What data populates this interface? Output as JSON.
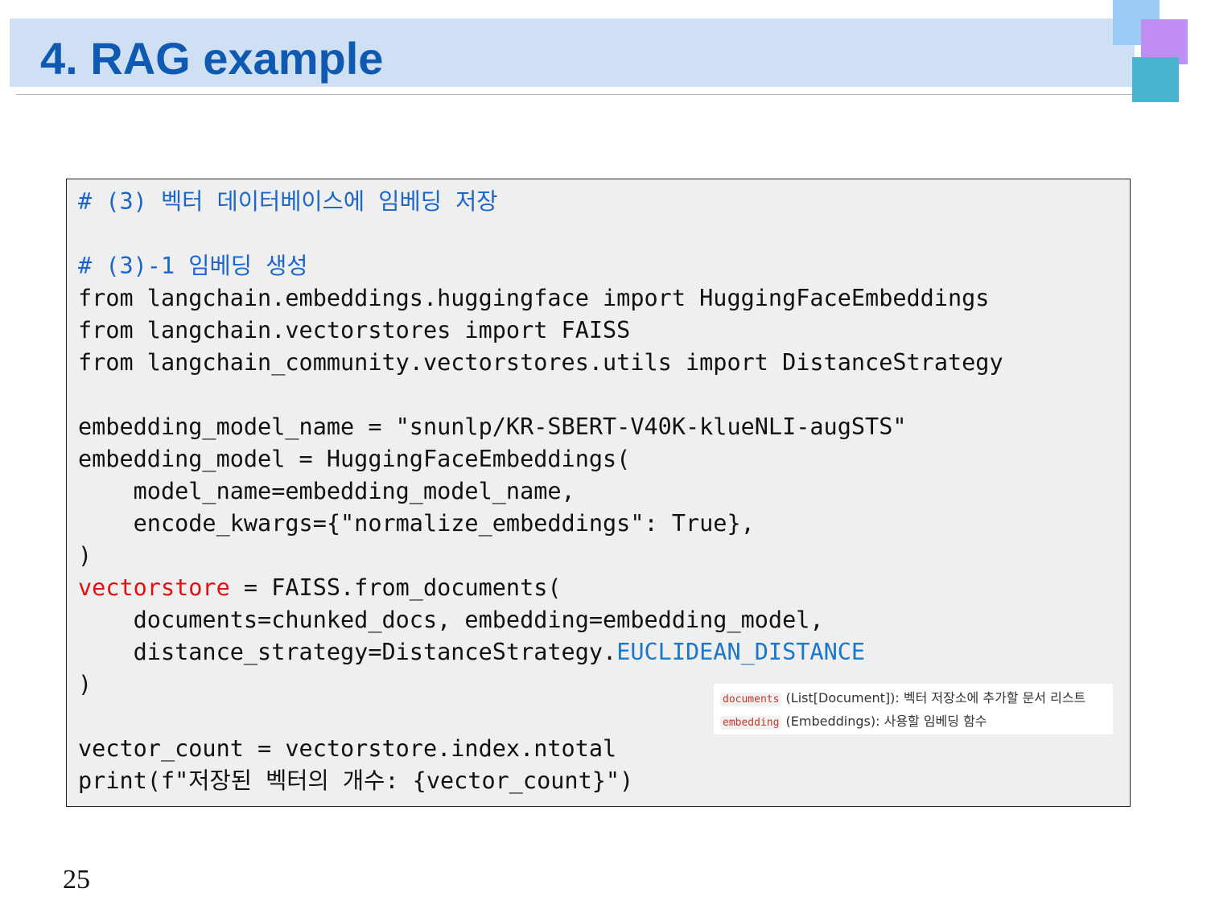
{
  "slide": {
    "title": "4. RAG example",
    "page_number": "25"
  },
  "colors": {
    "title_band": "#cfe0f5",
    "title_text": "#0f5ab0",
    "code_background": "#efefef",
    "comment": "#1a66cc",
    "highlight_red": "#e01010",
    "highlight_blue": "#1a77c9",
    "deco_square_blue": "#9ccbf7",
    "deco_square_purple": "#c18ef3",
    "deco_square_teal": "#49b5d1"
  },
  "code": {
    "l1": "# (3) 벡터 데이터베이스에 임베딩 저장",
    "l3": "# (3)-1 임베딩 생성",
    "l4": "from langchain.embeddings.huggingface import HuggingFaceEmbeddings",
    "l5": "from langchain.vectorstores import FAISS",
    "l6": "from langchain_community.vectorstores.utils import DistanceStrategy",
    "l8": "embedding_model_name = \"snunlp/KR-SBERT-V40K-klueNLI-augSTS\"",
    "l9": "embedding_model = HuggingFaceEmbeddings(",
    "l10": "    model_name=embedding_model_name,",
    "l11": "    encode_kwargs={\"normalize_embeddings\": True},",
    "l12": ")",
    "l13_var": "vectorstore",
    "l13_rest": " = FAISS.from_documents(",
    "l14": "    documents=chunked_docs, embedding=embedding_model,",
    "l15_pre": "    distance_strategy=DistanceStrategy.",
    "l15_const": "EUCLIDEAN_DISTANCE",
    "l16": ")",
    "l18": "vector_count = vectorstore.index.ntotal",
    "l19": "print(f\"저장된 벡터의 개수: {vector_count}\")"
  },
  "note": {
    "row1_code": "documents",
    "row1_text": "(List[Document]): 벡터 저장소에 추가할 문서 리스트",
    "row2_code": "embedding",
    "row2_text": "(Embeddings): 사용할 임베딩 함수"
  }
}
